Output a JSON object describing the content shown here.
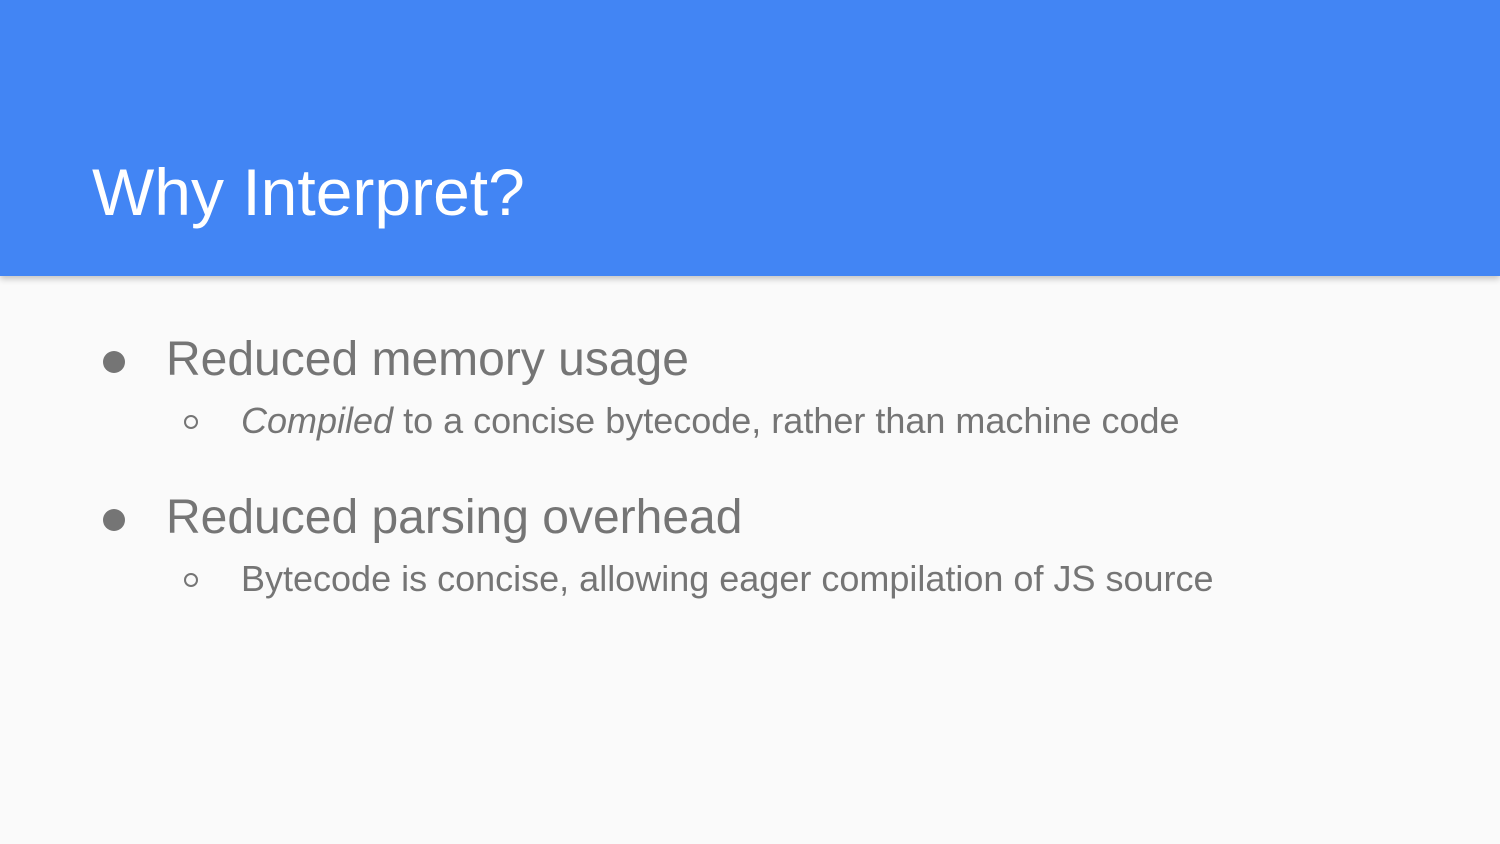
{
  "slide": {
    "title": "Why Interpret?",
    "bullets": [
      {
        "text": "Reduced memory usage",
        "sub": {
          "emphasis": "Compiled",
          "rest": " to a concise bytecode, rather than machine code"
        }
      },
      {
        "text": "Reduced parsing overhead",
        "sub": {
          "text": "Bytecode is concise, allowing eager compilation of JS source"
        }
      }
    ]
  },
  "colors": {
    "header": "#4285f4",
    "background": "#fafafa",
    "body_text": "#757575",
    "title_text": "#ffffff"
  }
}
